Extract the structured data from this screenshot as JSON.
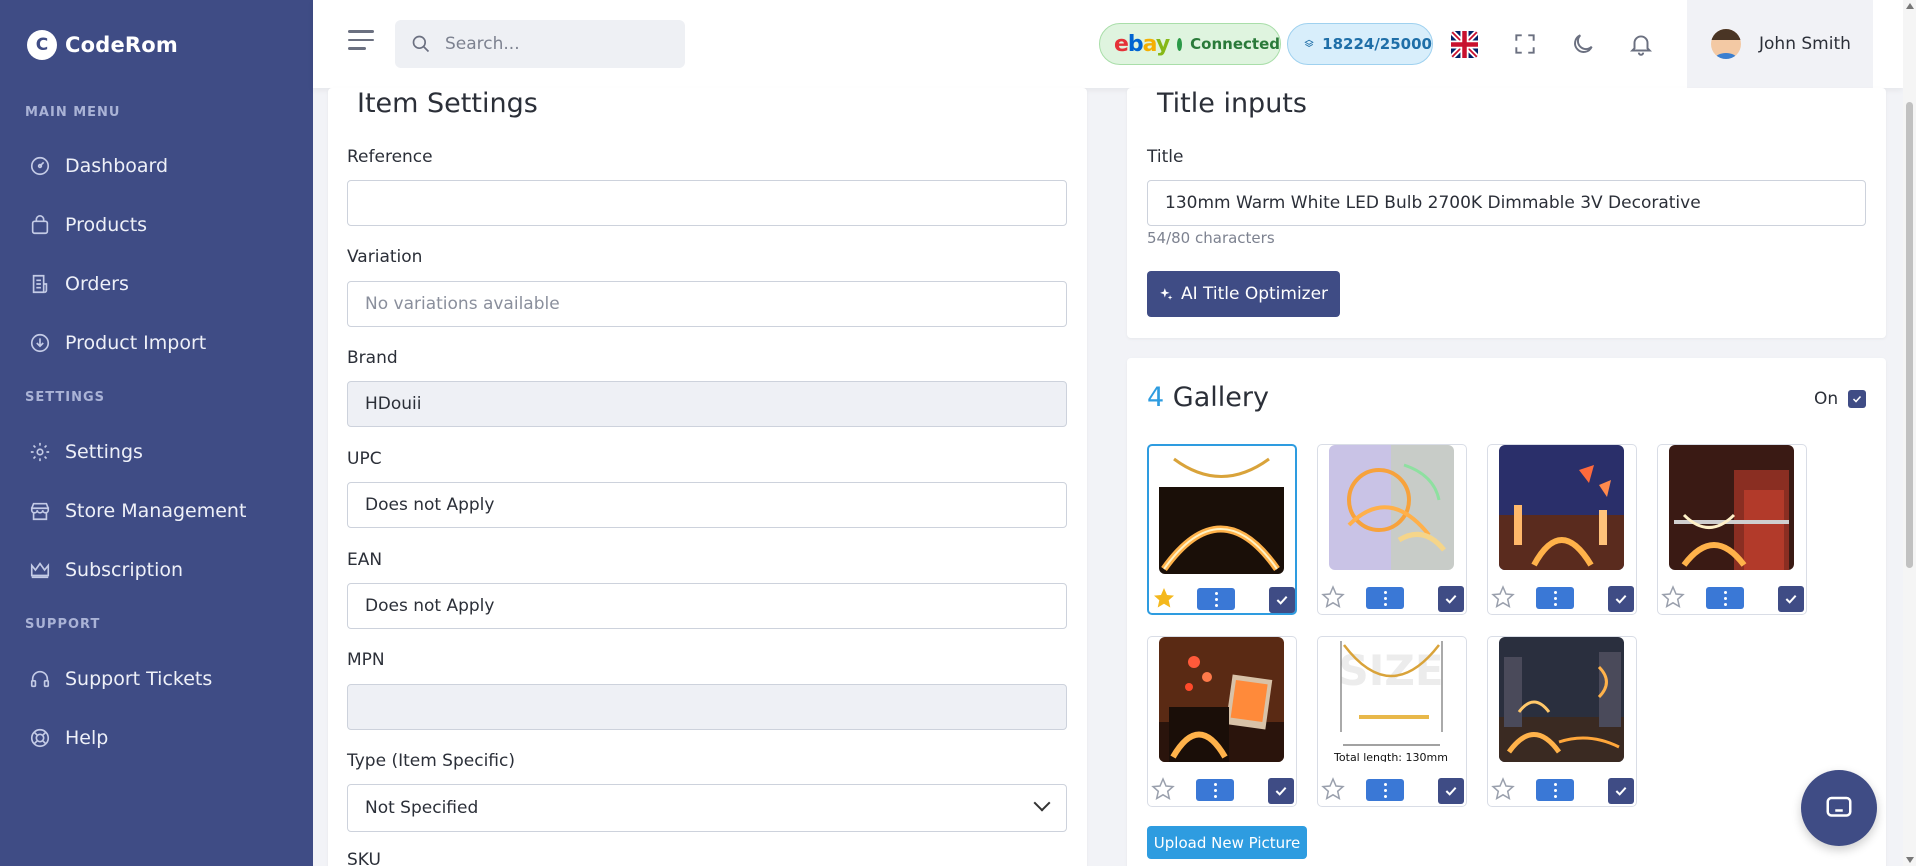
{
  "brand": {
    "name": "CodeRom"
  },
  "sidebar": {
    "sections": [
      {
        "label": "MAIN MENU"
      },
      {
        "label": "SETTINGS"
      },
      {
        "label": "SUPPORT"
      }
    ],
    "items": [
      {
        "label": "Dashboard",
        "icon": "gauge-icon"
      },
      {
        "label": "Products",
        "icon": "bag-icon"
      },
      {
        "label": "Orders",
        "icon": "receipt-icon"
      },
      {
        "label": "Product Import",
        "icon": "cloud-download-icon"
      },
      {
        "label": "Settings",
        "icon": "gear-icon"
      },
      {
        "label": "Store Management",
        "icon": "store-icon"
      },
      {
        "label": "Subscription",
        "icon": "crown-icon"
      },
      {
        "label": "Support Tickets",
        "icon": "headset-icon"
      },
      {
        "label": "Help",
        "icon": "lifebuoy-icon"
      }
    ]
  },
  "header": {
    "search_placeholder": "Search...",
    "ebay_logo": "ebay",
    "ebay_status": "Connected",
    "credits": "18224/25000",
    "user_name": "John Smith"
  },
  "item_settings": {
    "title": "Item Settings",
    "fields": {
      "reference": {
        "label": "Reference",
        "value": ""
      },
      "variation": {
        "label": "Variation",
        "placeholder": "No variations available"
      },
      "brand": {
        "label": "Brand",
        "value": "HDouii"
      },
      "upc": {
        "label": "UPC",
        "value": "Does not Apply"
      },
      "ean": {
        "label": "EAN",
        "value": "Does not Apply"
      },
      "mpn": {
        "label": "MPN",
        "value": ""
      },
      "type": {
        "label": "Type (Item Specific)",
        "value": "Not Specified"
      },
      "sku": {
        "label": "SKU"
      }
    }
  },
  "title_inputs": {
    "title": "Title inputs",
    "title_label": "Title",
    "title_value": "130mm Warm White LED Bulb 2700K Dimmable 3V Decorative",
    "char_count": "54/80 characters",
    "optimizer_label": "AI Title Optimizer"
  },
  "gallery": {
    "count": "4",
    "title": "Gallery",
    "toggle_label": "On",
    "upload_label": "Upload New Picture",
    "images": [
      {
        "primary": true
      },
      {
        "primary": false
      },
      {
        "primary": false
      },
      {
        "primary": false
      },
      {
        "primary": false
      },
      {
        "primary": false,
        "overlay_text": "Total length: 130mm",
        "watermark": "SIZE"
      },
      {
        "primary": false
      }
    ]
  },
  "colors": {
    "sidebar": "#3f4c85",
    "accent": "#2e9ce0",
    "button": "#3f4c85"
  }
}
